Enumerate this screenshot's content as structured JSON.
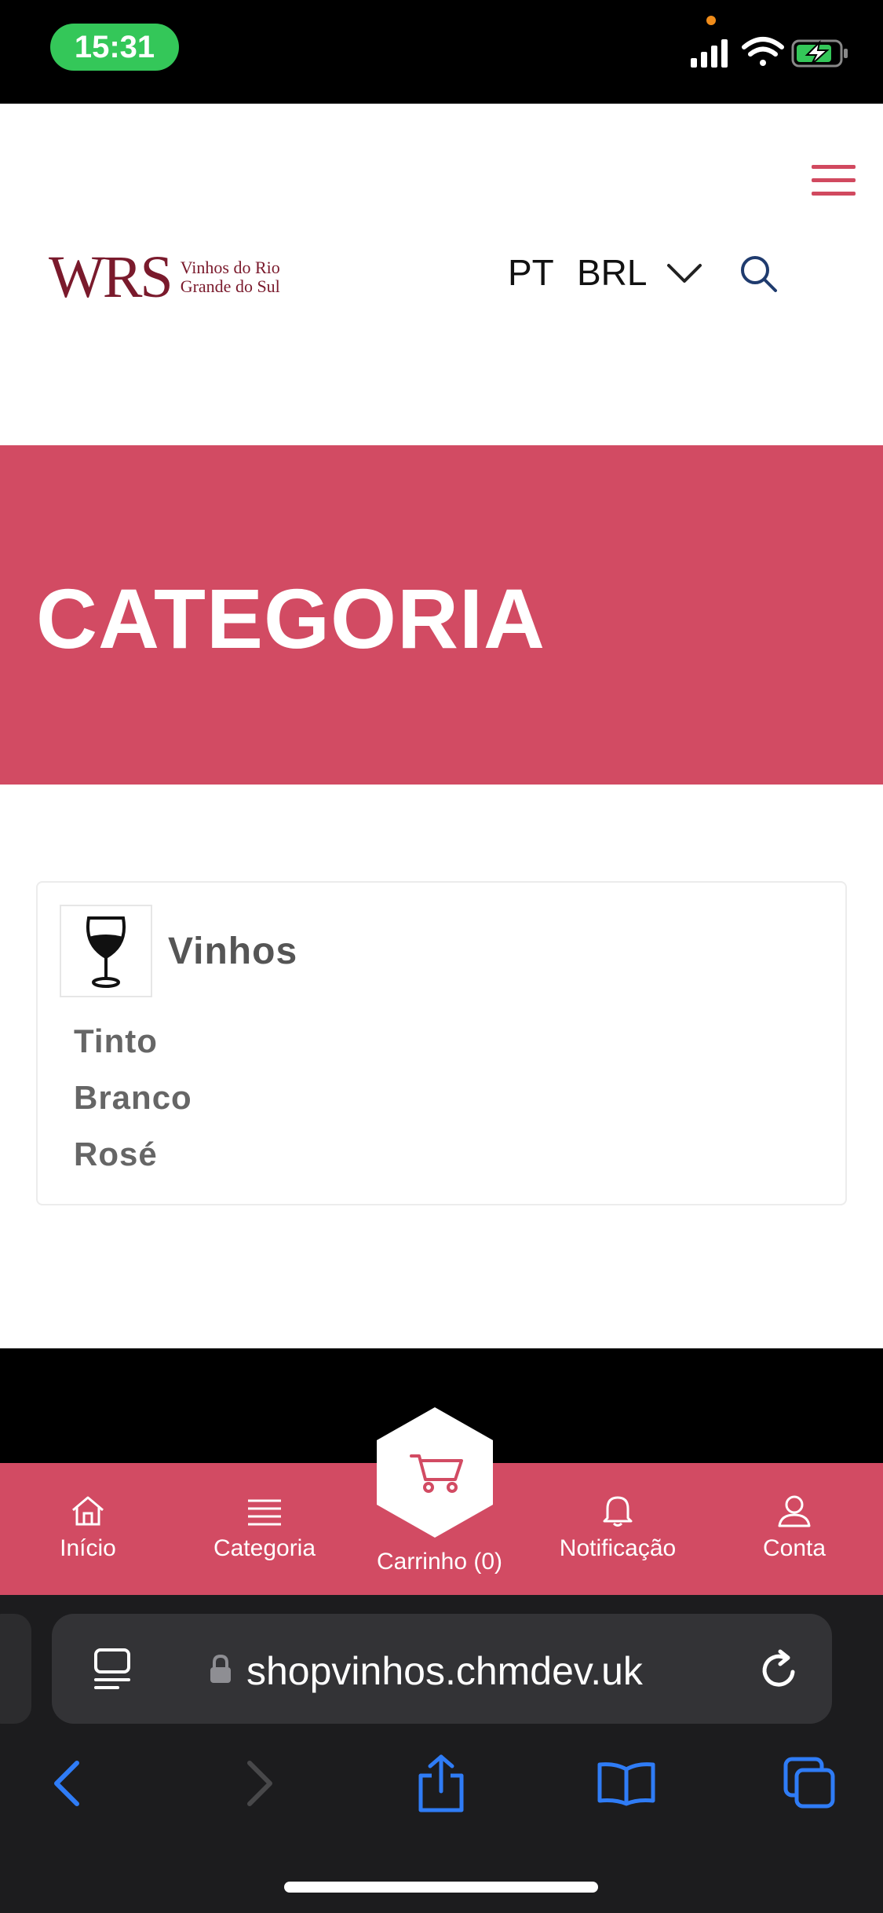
{
  "status_bar": {
    "time": "15:31"
  },
  "header": {
    "logo_text": "WRS",
    "logo_subtitle": "Vinhos do Rio Grande do Sul",
    "language": "PT",
    "currency": "BRL"
  },
  "hero": {
    "title": "CATEGORIA"
  },
  "category_card": {
    "title": "Vinhos",
    "items": [
      "Tinto",
      "Branco",
      "Rosé"
    ]
  },
  "bottom_nav": {
    "items": [
      {
        "label": "Início",
        "icon": "home-icon"
      },
      {
        "label": "Categoria",
        "icon": "list-icon"
      },
      {
        "label": "Carrinho (0)",
        "icon": "cart-icon"
      },
      {
        "label": "Notificação",
        "icon": "bell-icon"
      },
      {
        "label": "Conta",
        "icon": "user-icon"
      }
    ]
  },
  "browser": {
    "url": "shopvinhos.chmdev.uk"
  },
  "colors": {
    "accent": "#d24b63",
    "logo": "#7a1a2c",
    "ios_blue": "#2f7cf6"
  }
}
